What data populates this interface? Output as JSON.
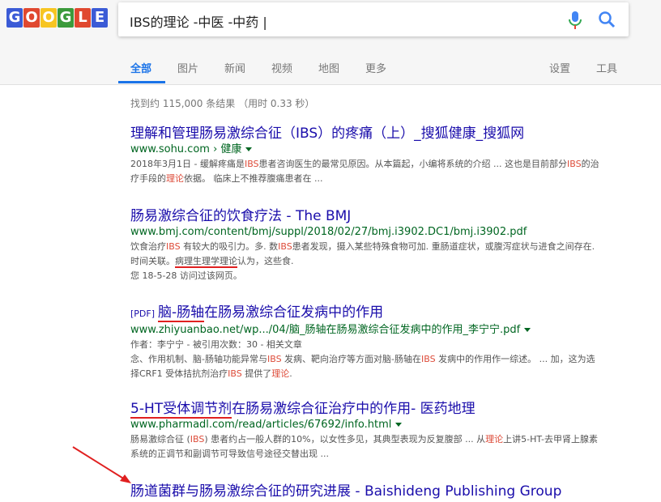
{
  "logo": {
    "letters": [
      "G",
      "O",
      "O",
      "G",
      "L",
      "E"
    ],
    "colors": [
      "#3b5bd6",
      "#e0482f",
      "#f7c521",
      "#3b9a3b",
      "#e0482f",
      "#3b5bd6"
    ]
  },
  "search": {
    "query": "IBS的理论 -中医 -中药 |"
  },
  "tabs": [
    "全部",
    "图片",
    "新闻",
    "视频",
    "地图",
    "更多"
  ],
  "tools": [
    "设置",
    "工具"
  ],
  "stats": "找到约 115,000 条结果 （用时 0.33 秒）",
  "results": [
    {
      "title": "理解和管理肠易激综合征（IBS）的疼痛（上）_搜狐健康_搜狐网",
      "url": "www.sohu.com › 健康",
      "snippet_a": "2018年3月1日 - 缓解疼痛是",
      "snippet_b": "IBS",
      "snippet_c": "患者咨询医生的最常见原因。从本篇起，小编将系统的介绍 ... 这也是目前部分",
      "snippet_d": "IBS",
      "snippet_e": "的治疗手段的",
      "snippet_f": "理论",
      "snippet_g": "依据。 临床上不推荐腹痛患者在 ..."
    },
    {
      "title": "肠易激综合征的饮食疗法 - The BMJ",
      "url": "www.bmj.com/content/bmj/suppl/2018/02/27/bmj.i3902.DC1/bmj.i3902.pdf",
      "snippet_a": "饮食治疗",
      "snippet_b": "IBS",
      "snippet_c": " 有较大的吸引力。多. 数",
      "snippet_d": "IBS",
      "snippet_e": "患者发现，摄入某些特殊食物可加. 重肠道症状，或腹泻症状与进食之间存在. 时间关联。",
      "snippet_f": "病理生理学理论",
      "snippet_g": "认为，这些食.",
      "visited": "您 18-5-28 访问过该网页。"
    },
    {
      "pdf": "[PDF]",
      "title_a": "脑-肠轴",
      "title_b": "在肠易激综合征发病中的作用",
      "url": "www.zhiyuanbao.net/wp.../04/脑_肠轴在肠易激综合征发病中的作用_李宁宁.pdf",
      "meta": "作者：李宁宁 - 被引用次数：30 - 相关文章",
      "snippet_a": "念、作用机制、脑-肠轴功能异常与",
      "snippet_b": "IBS",
      "snippet_c": " 发病、靶向治疗等方面对脑-肠轴在",
      "snippet_d": "IBS",
      "snippet_e": " 发病中的作用作一综述。 ... 加，这为选择CRF1 受体拮抗剂治疗",
      "snippet_f": "IBS",
      "snippet_g": " 提供了",
      "snippet_h": "理论",
      "snippet_i": "."
    },
    {
      "title_a": "5-HT受体调节剂",
      "title_b": "在肠易激综合征治疗中的作用- 医药地理",
      "url": "www.pharmadl.com/read/articles/67692/info.html",
      "snippet_a": "肠易激综合征 (",
      "snippet_b": "IBS",
      "snippet_c": ") 患者约占一般人群的10%，以女性多见，其典型表现为反复腹部 ... 从",
      "snippet_d": "理论",
      "snippet_e": "上讲5-HT-去甲肾上腺素系统的正调节和副调节可导致信号途径交替出现 ..."
    },
    {
      "title": "肠道菌群与肠易激综合征的研究进展 - Baishideng Publishing Group"
    }
  ]
}
